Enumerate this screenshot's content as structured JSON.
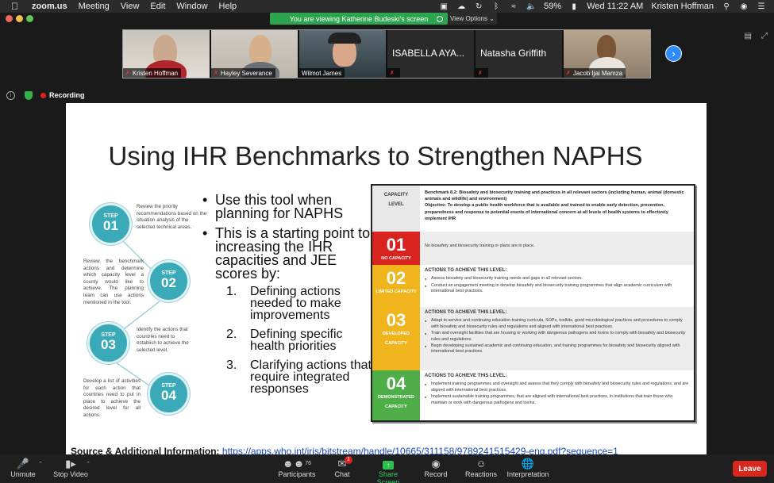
{
  "menubar": {
    "app": "zoom.us",
    "menus": [
      "Meeting",
      "View",
      "Edit",
      "Window",
      "Help"
    ],
    "battery": "59%",
    "datetime": "Wed 11:22 AM",
    "user": "Kristen Hoffman"
  },
  "banner": {
    "text": "You are viewing Katherine Budeski's screen",
    "view_options": "View Options"
  },
  "participants": [
    {
      "name": "Kristen Hoffman"
    },
    {
      "name": "Hayley Severance"
    },
    {
      "name": "Wilmot James"
    },
    {
      "name": "ISABELLA AYA..."
    },
    {
      "name": "Natasha Griffith"
    },
    {
      "name": "Jacob Ijai Mamza"
    }
  ],
  "status": {
    "recording": "Recording"
  },
  "slide": {
    "title": "Using IHR Benchmarks to Strengthen NAPHS",
    "steps": [
      {
        "label": "STEP",
        "num": "01",
        "text": "Review the priority recommendations based on the situation analysis of the selected technical areas."
      },
      {
        "label": "STEP",
        "num": "02",
        "text": "Review the benchmark actions and determine which capacity level a county would like to achieve. The planning team can use actions mentioned in the tool."
      },
      {
        "label": "STEP",
        "num": "03",
        "text": "Identify the actions that countries need to establish to achieve the selected level."
      },
      {
        "label": "STEP",
        "num": "04",
        "text": "Develop a list of activities for each action that countries need to put in place to achieve the desired level for all actions."
      }
    ],
    "bullets": [
      "Use this tool when planning for NAPHS",
      "This is a starting point to increasing the IHR capacities and JEE scores by:"
    ],
    "sub_items": [
      {
        "num": "1.",
        "text": "Defining actions needed to make improvements"
      },
      {
        "num": "2.",
        "text": "Defining specific health priorities"
      },
      {
        "num": "3.",
        "text": "Clarifying actions that require integrated responses"
      }
    ],
    "benchmark": {
      "cap_label_1": "CAPACITY",
      "cap_label_2": "LEVEL",
      "title": "Benchmark 8.2: Biosafety and biosecurity training and practices in all relevant sectors (including human, animal (domestic animals and wildlife) and environment)",
      "objective": "Objective: To develop a public health workforce that is available and trained to enable early detection, prevention, preparedness and response to potential events of international concern at all levels of health systems to effectively implement IHR",
      "levels": [
        {
          "num": "01",
          "label": "NO CAPACITY",
          "color": "#d9231f",
          "title": "",
          "items": [
            "No biosafety and biosecurity training or plans are in place."
          ]
        },
        {
          "num": "02",
          "label": "LIMITED CAPACITY",
          "color": "#f0b51c",
          "title": "ACTIONS TO ACHIEVE THIS LEVEL:",
          "items": [
            "Assess biosafety and biosecurity training needs and gaps in all relevant sectors.",
            "Conduct an engagement meeting to develop biosafety and biosecurity training programmes that align academic curriculum with international best practices."
          ]
        },
        {
          "num": "03",
          "label": "DEVELOPED CAPACITY",
          "color": "#f0b51c",
          "title": "ACTIONS TO ACHIEVE THIS LEVEL:",
          "items": [
            "Adapt in-service and continuing education training curricula, SOPs, toolkits, good microbiological practices and procedures to comply with biosafety and biosecurity rules and regulations and aligned with international best practices.",
            "Train and oversight facilities that are housing or working with dangerous pathogens and toxins to comply with biosafety and biosecurity rules and regulations.",
            "Begin developing sustained academic and continuing education, and training programmes for biosafety and biosecurity aligned with international best practices."
          ]
        },
        {
          "num": "04",
          "label": "DEMONSTRATED CAPACITY",
          "color": "#4fae48",
          "title": "ACTIONS TO ACHIEVE THIS LEVEL:",
          "items": [
            "Implement training programmes and oversight and assess that they comply with biosafety and biosecurity rules and regulations, and are aligned with international best practices.",
            "Implement sustainable training programmes, that are aligned with international best practices, in institutions that train those who maintain or work with dangerous pathogens and toxins."
          ]
        }
      ]
    },
    "source_label": "Source & Additional Information:",
    "source_url": "https://apps.who.int/iris/bitstream/handle/10665/311158/9789241515429-eng.pdf?sequence=1"
  },
  "toolbar": {
    "unmute": "Unmute",
    "stop_video": "Stop Video",
    "participants": "Participants",
    "participant_count": "76",
    "chat": "Chat",
    "chat_badge": "1",
    "share_screen": "Share Screen",
    "record": "Record",
    "reactions": "Reactions",
    "interpretation": "Interpretation",
    "leave": "Leave"
  }
}
